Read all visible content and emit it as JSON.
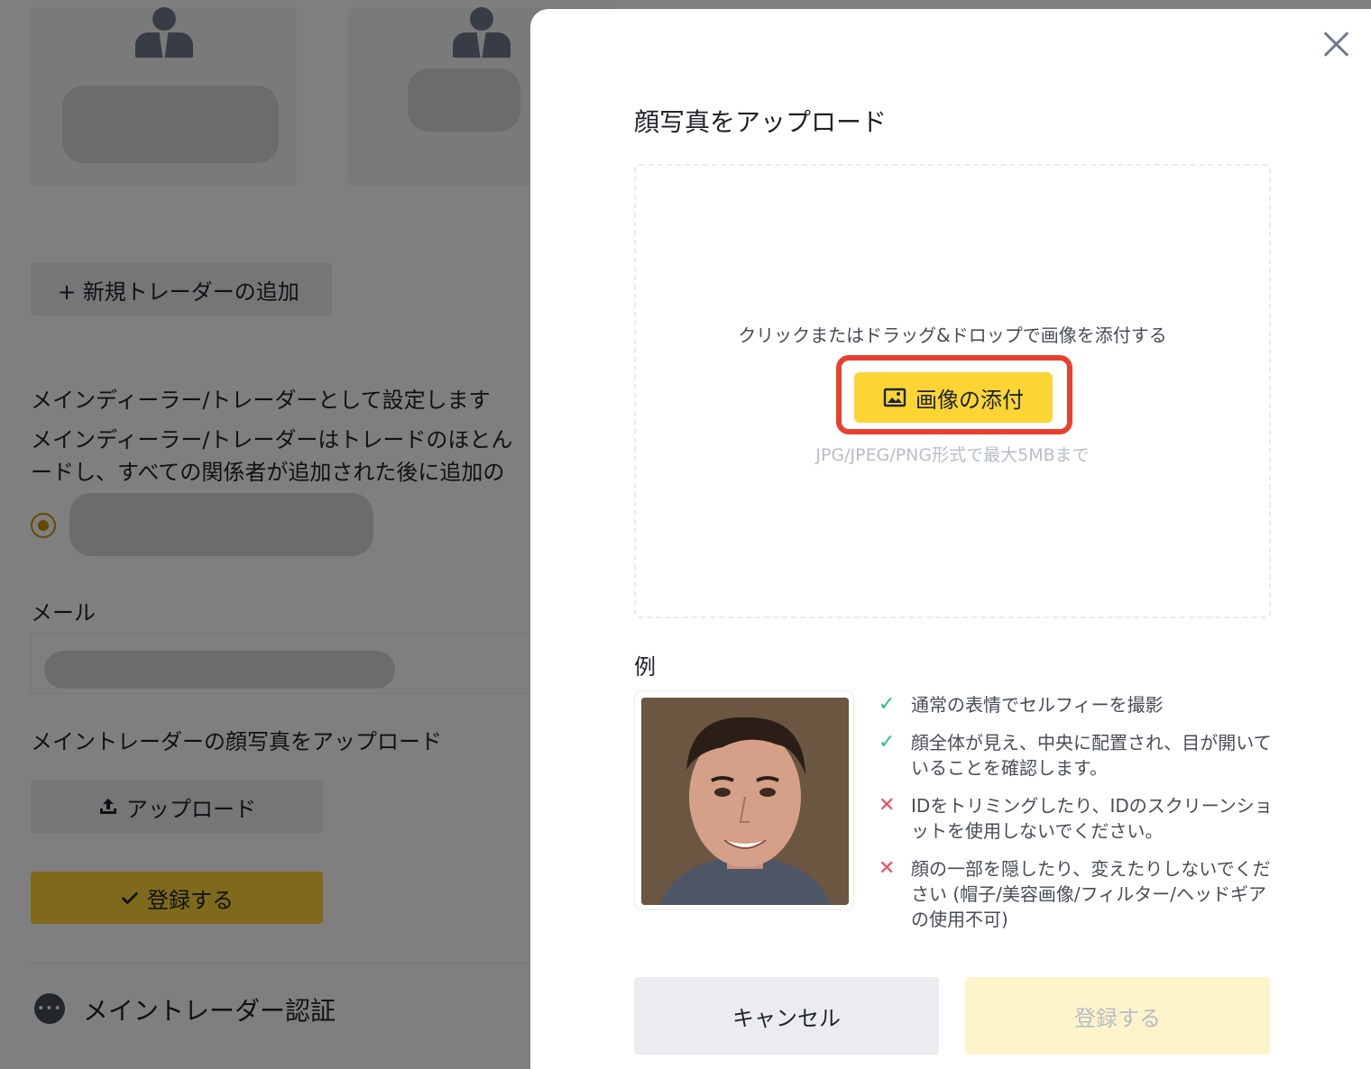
{
  "background": {
    "add_trader_label": "+ 新規トレーダーの追加",
    "main_dealer_heading": "メインディーラー/トレーダーとして設定します",
    "main_dealer_desc_1": "メインディーラー/トレーダーはトレードのほとん",
    "main_dealer_desc_2": "ードし、すべての関係者が追加された後に追加の",
    "email_label": "メール",
    "face_upload_label": "メイントレーダーの顔写真をアップロード",
    "upload_button_label": "アップロード",
    "register_button_label": "登録する",
    "main_auth_label": "メイントレーダー認証",
    "dots_glyph": "•••"
  },
  "modal": {
    "title": "顔写真をアップロード",
    "dropzone_hint": "クリックまたはドラッグ&ドロップで画像を添付する",
    "attach_button_label": "画像の添付",
    "dropzone_limit": "JPG/JPEG/PNG形式で最大5MBまで",
    "example_label": "例",
    "rules": [
      {
        "type": "ok",
        "text": "通常の表情でセルフィーを撮影"
      },
      {
        "type": "ok",
        "text": "顔全体が見え、中央に配置され、目が開いていることを確認します。"
      },
      {
        "type": "ng",
        "text": "IDをトリミングしたり、IDのスクリーンショットを使用しないでください。"
      },
      {
        "type": "ng",
        "text": "顔の一部を隠したり、変えたりしないでください (帽子/美容画像/フィルター/ヘッドギアの使用不可)"
      }
    ],
    "cancel_label": "キャンセル",
    "submit_label": "登録する"
  },
  "colors": {
    "brand_yellow": "#fcd535",
    "highlight_red": "#e8402d",
    "ok_green": "#2ebd85",
    "ng_red": "#f6465d"
  }
}
